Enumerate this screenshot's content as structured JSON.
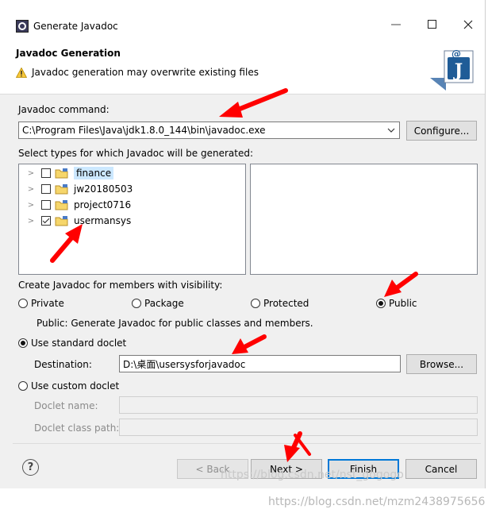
{
  "window": {
    "title": "Generate Javadoc",
    "minimize": "—",
    "maximize": "☐",
    "close": "✕"
  },
  "header": {
    "title": "Javadoc Generation",
    "warning": "Javadoc generation may overwrite existing files"
  },
  "command": {
    "label": "Javadoc command:",
    "value": "C:\\Program Files\\Java\\jdk1.8.0_144\\bin\\javadoc.exe",
    "configure_label": "Configure..."
  },
  "types": {
    "label": "Select types for which Javadoc will be generated:",
    "items": [
      {
        "name": "finance",
        "checked": false,
        "selected": true
      },
      {
        "name": "jw20180503",
        "checked": false,
        "selected": false
      },
      {
        "name": "project0716",
        "checked": false,
        "selected": false
      },
      {
        "name": "usermansys",
        "checked": true,
        "selected": false
      }
    ]
  },
  "visibility": {
    "label": "Create Javadoc for members with visibility:",
    "options": [
      "Private",
      "Package",
      "Protected",
      "Public"
    ],
    "selected": "Public",
    "description": "Public: Generate Javadoc for public classes and members."
  },
  "standard_doclet": {
    "label": "Use standard doclet",
    "destination_label": "Destination:",
    "destination_value": "D:\\桌面\\usersysforjavadoc",
    "browse_label": "Browse..."
  },
  "custom_doclet": {
    "label": "Use custom doclet",
    "name_label": "Doclet name:",
    "classpath_label": "Doclet class path:"
  },
  "footer": {
    "help": "?",
    "back_label": "< Back",
    "next_label": "Next >",
    "finish_label": "Finish",
    "cancel_label": "Cancel"
  },
  "watermarks": {
    "overlay": "https://blog.csdn.net/nst_gogogo",
    "bottom": "https://blog.csdn.net/mzm2438975656"
  },
  "colors": {
    "accent": "#0078d7",
    "annotation_arrow": "#ff0000",
    "selection": "#cce8ff"
  }
}
